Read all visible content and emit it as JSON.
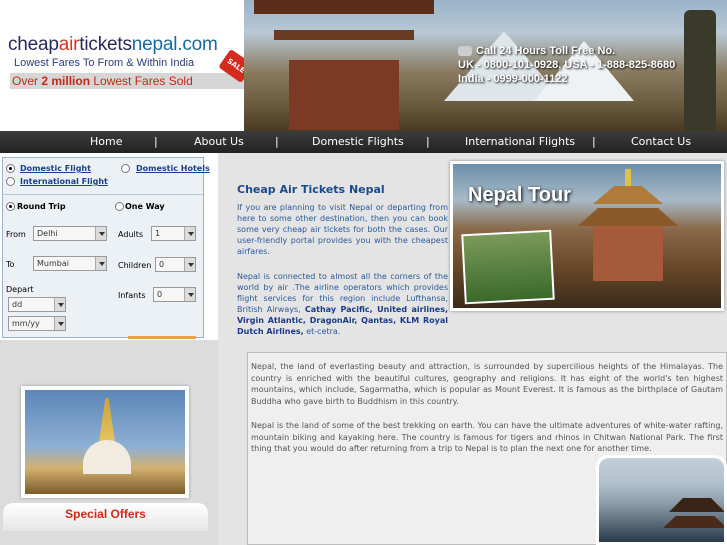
{
  "header": {
    "logo": {
      "part1": "cheap",
      "part2": "air",
      "part3": "tickets",
      "part4": "nepal.com"
    },
    "tagline": "Lowest Fares To From & Within India",
    "promo_prefix": "Over ",
    "promo_bold": "2 million",
    "promo_suffix": " Lowest Fares Sold",
    "sale_badge": "SALE",
    "phone_line1": "Call 24 Hours Toll Free No.",
    "phone_line2": "UK - 0800-101-0928, USA - 1-888-825-8680",
    "phone_line3": "India - 0999-000-1122"
  },
  "nav": {
    "items": [
      "Home",
      "About Us",
      "Domestic Flights",
      "International Flights",
      "Contact Us"
    ],
    "separator": "|"
  },
  "search": {
    "domestic_flight": "Domestic Flight",
    "domestic_hotels": "Domestic Hotels",
    "international_flight": "International Flight",
    "round_trip": "Round Trip",
    "one_way": "One Way",
    "from_label": "From",
    "from_value": "Delhi",
    "to_label": "To",
    "to_value": "Mumbai",
    "adults_label": "Adults",
    "adults_value": "1",
    "children_label": "Children",
    "children_value": "0",
    "infants_label": "Infants",
    "infants_value": "0",
    "depart_label": "Depart",
    "day_value": "dd",
    "month_value": "mm/yy"
  },
  "left": {
    "special_offers": "Special Offers"
  },
  "main": {
    "title": "Cheap Air Tickets Nepal",
    "para1": "If you are planning to visit Nepal or departing from here to some other destination, then you can book some very cheap air tickets for both the cases. Our user-friendly portal provides you with the cheapest airfares.",
    "para2_start": "Nepal is connected to almost all the corners of the world by air .The airline operators which provides flight services for this region include Lufthansa, British Airways, ",
    "para2_bold": "Cathay Pacific, United airlines, Virgin Atlantic, DragonAir, Qantas, KLM Royal Dutch Airlines,",
    "para2_end": " et-cetra.",
    "tour_image_title": "Nepal Tour",
    "lower_para1": "Nepal, the land of everlasting beauty and attraction, is surrounded by supercilious heights of the Himalayas. The country is enriched with the beautiful cultures, geography and religions. It has eight of the world's ten highest mountains, which include, Sagarmatha, which is popular as Mount Everest. It is famous as the birthplace of Gautam Buddha who gave birth to Buddhism in this country.",
    "lower_para2": "Nepal is the land of some of the best trekking on earth. You can have the ultimate adventures of white-water rafting, mountain biking and kayaking here. The country is famous for tigers and rhinos in Chitwan National Park. The first thing that you would do after returning from a trip to Nepal is to plan the next one for another time."
  },
  "icons": {
    "phone": "phone-icon",
    "dropdown": "chevron-down-icon"
  },
  "colors": {
    "nav_bg": "#2a2a2a",
    "link_blue": "#1b3f8f",
    "title_blue": "#1a4a8a",
    "accent_red": "#d12b1b"
  }
}
